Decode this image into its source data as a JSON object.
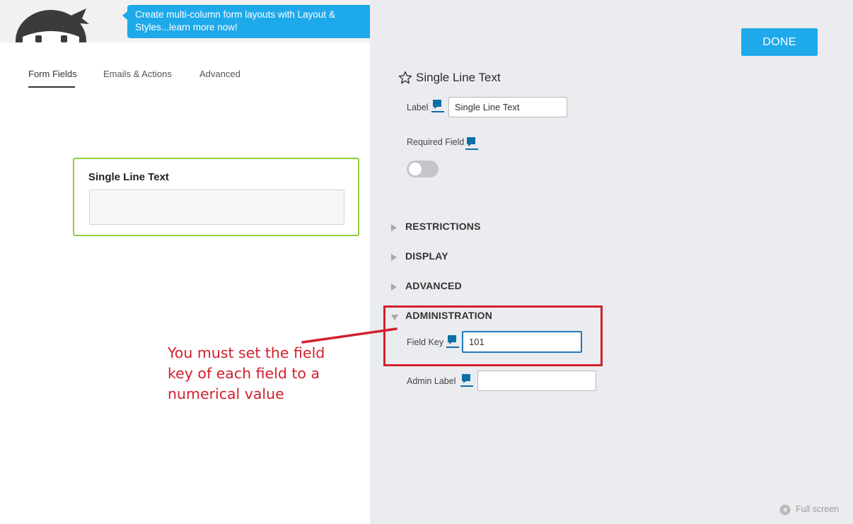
{
  "promo": {
    "text": "Create multi-column form layouts with Layout & Styles...learn more now!"
  },
  "tabs": [
    {
      "label": "Form Fields",
      "active": true
    },
    {
      "label": "Emails & Actions",
      "active": false
    },
    {
      "label": "Advanced",
      "active": false
    }
  ],
  "field_card": {
    "title": "Single Line Text"
  },
  "annotation": {
    "text": "You must set the field key of each field to a numerical value"
  },
  "settings_panel": {
    "done_label": "DONE",
    "title": "Single Line Text",
    "label_field": {
      "label": "Label",
      "value": "Single Line Text"
    },
    "required_field": {
      "label": "Required Field",
      "enabled": false
    },
    "sections": [
      {
        "label": "RESTRICTIONS",
        "expanded": false
      },
      {
        "label": "DISPLAY",
        "expanded": false
      },
      {
        "label": "ADVANCED",
        "expanded": false
      },
      {
        "label": "ADMINISTRATION",
        "expanded": true
      }
    ],
    "field_key": {
      "label": "Field Key",
      "value": "101"
    },
    "admin_label": {
      "label": "Admin Label",
      "value": ""
    }
  },
  "fullscreen": {
    "label": "Full screen"
  },
  "colors": {
    "accent_blue": "#1ea9ea",
    "focus_blue": "#1f7ab6",
    "help_icon_blue": "#0c6fa6",
    "success_green": "#8fce3b",
    "annotation_red": "#d2202e",
    "panel_bg": "#ebecef"
  }
}
